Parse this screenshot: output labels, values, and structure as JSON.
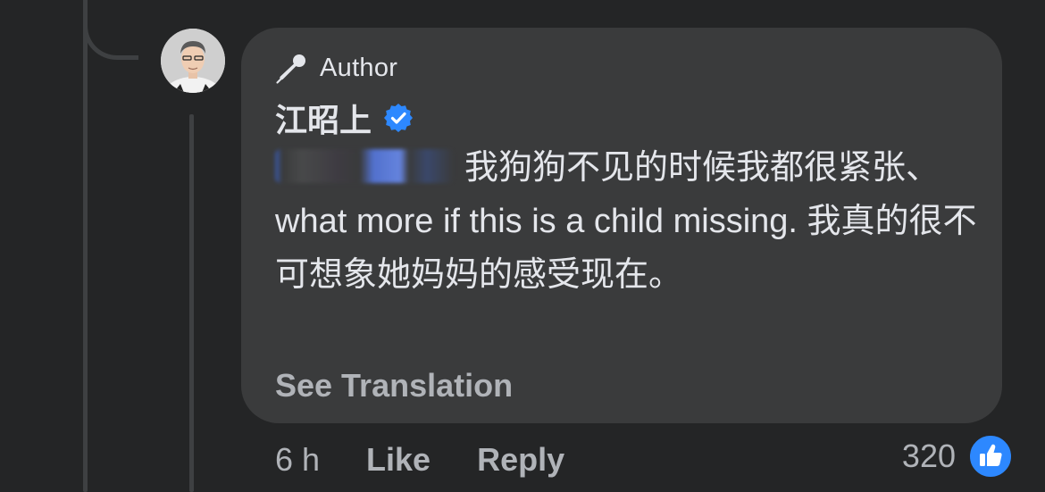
{
  "comment": {
    "badge_label": "Author",
    "author_name": "江昭上",
    "verified": true,
    "mention_redacted": true,
    "body_text": "我狗狗不见的时候我都很紧张、what more if this is a child missing. 我真的很不可想象她妈妈的感受现在。",
    "see_translation_label": "See Translation"
  },
  "actions": {
    "timestamp": "6 h",
    "like_label": "Like",
    "reply_label": "Reply"
  },
  "reactions": {
    "count": "320",
    "icon": "like-reaction-icon"
  },
  "icons": {
    "badge": "microphone-icon",
    "verified": "verified-badge-icon"
  },
  "colors": {
    "background": "#242526",
    "bubble": "#3a3b3c",
    "text_primary": "#e4e6eb",
    "text_secondary": "#b0b3b8",
    "accent_blue": "#2d88ff"
  }
}
